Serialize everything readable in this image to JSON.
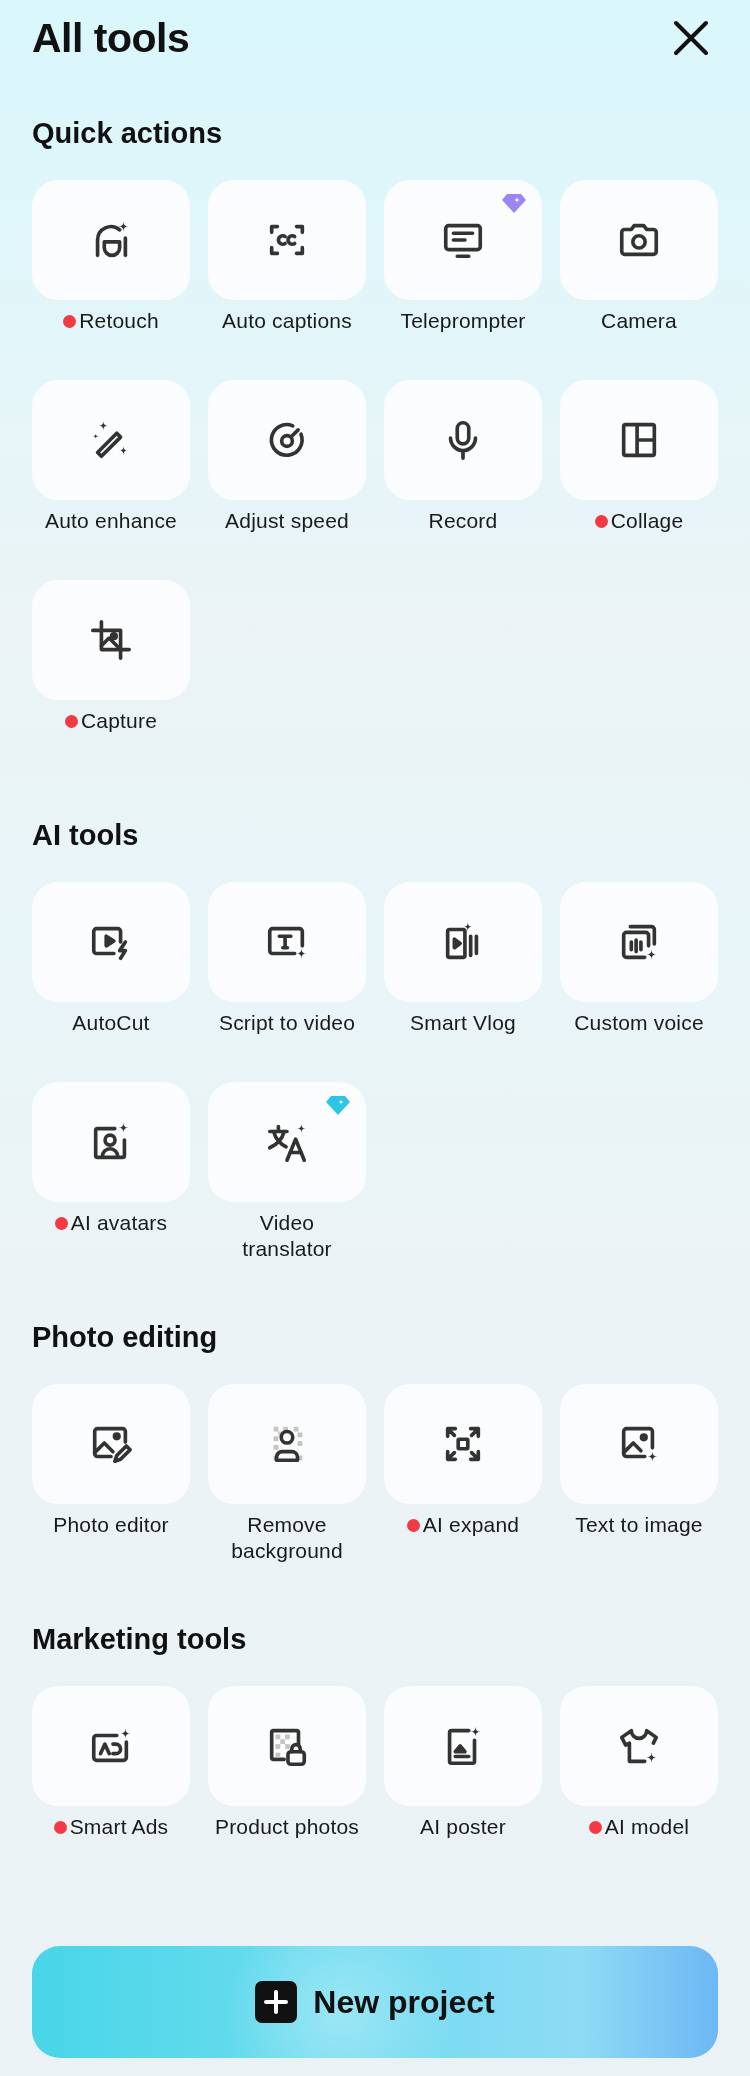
{
  "title": "All tools",
  "sections": [
    {
      "heading": "Quick actions",
      "tools": [
        {
          "label": "Retouch",
          "new": true,
          "premium": false
        },
        {
          "label": "Auto captions",
          "new": false,
          "premium": false
        },
        {
          "label": "Teleprompter",
          "new": false,
          "premium": true,
          "color": "#9b86f3"
        },
        {
          "label": "Camera",
          "new": false,
          "premium": false
        },
        {
          "label": "Auto enhance",
          "new": false,
          "premium": false
        },
        {
          "label": "Adjust speed",
          "new": false,
          "premium": false
        },
        {
          "label": "Record",
          "new": false,
          "premium": false
        },
        {
          "label": "Collage",
          "new": true,
          "premium": false
        },
        {
          "label": "Capture",
          "new": true,
          "premium": false
        }
      ]
    },
    {
      "heading": "AI tools",
      "tools": [
        {
          "label": "AutoCut",
          "new": false,
          "premium": false
        },
        {
          "label": "Script to video",
          "new": false,
          "premium": false
        },
        {
          "label": "Smart Vlog",
          "new": false,
          "premium": false
        },
        {
          "label": "Custom voice",
          "new": false,
          "premium": false
        },
        {
          "label": "AI avatars",
          "new": true,
          "premium": false
        },
        {
          "label": "Video\ntranslator",
          "new": false,
          "premium": true,
          "color": "#2cc6e2"
        }
      ]
    },
    {
      "heading": "Photo editing",
      "tools": [
        {
          "label": "Photo editor",
          "new": false,
          "premium": false
        },
        {
          "label": "Remove\nbackground",
          "new": false,
          "premium": false
        },
        {
          "label": "AI expand",
          "new": true,
          "premium": false
        },
        {
          "label": "Text to image",
          "new": false,
          "premium": false
        }
      ]
    },
    {
      "heading": "Marketing tools",
      "tools": [
        {
          "label": "Smart Ads",
          "new": true,
          "premium": false
        },
        {
          "label": "Product photos",
          "new": false,
          "premium": false
        },
        {
          "label": "AI poster",
          "new": false,
          "premium": false
        },
        {
          "label": "AI model",
          "new": true,
          "premium": false
        }
      ]
    }
  ],
  "new_project_button": {
    "label": "New project"
  }
}
